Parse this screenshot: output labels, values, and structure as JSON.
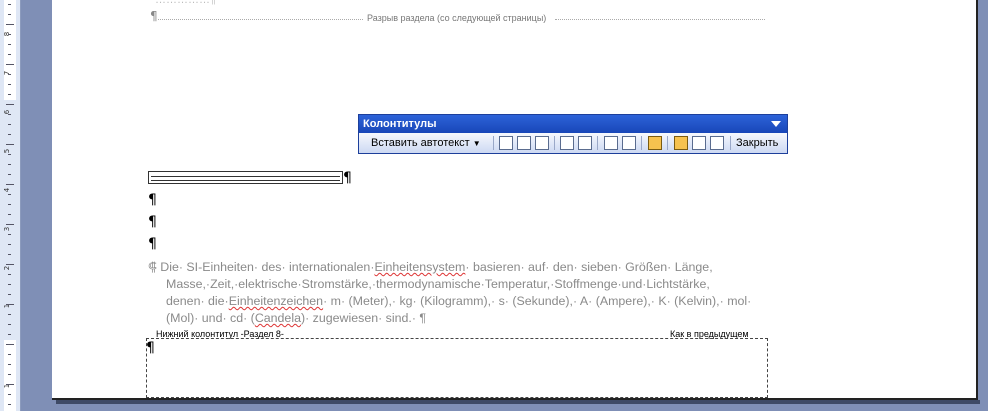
{
  "ruler": {
    "numbers": [
      "8",
      "7",
      "6",
      "5",
      "4",
      "3",
      "2",
      "1",
      "1"
    ]
  },
  "document": {
    "top_partial_text": "……………¶",
    "section_break_mark": "¶",
    "section_break_label": "Разрыв раздела (со следующей страницы)",
    "table_end_mark": "¶",
    "empty_para_1": "¶",
    "empty_para_2": "¶",
    "empty_para_3": "¶",
    "body_anchor": "⸿",
    "body_line1_a": "Die· SI-Einheiten· des· internationalen·",
    "body_line1_b": "Einheitensystem",
    "body_line1_c": "· basieren· auf· den· sieben· Größen· Länge,",
    "body_line2": "Masse,·Zeit,·elektrische·Stromstärke,·thermodynamische·Temperatur,·Stoffmenge·und·Lichtstärke,",
    "body_line3_a": "denen· die·",
    "body_line3_b": "Einheitenzeichen",
    "body_line3_c": "· m· (Meter),· kg· (Kilogramm),· s· (Sekunde),· A· (Ampere),· K· (Kelvin),· mol·",
    "body_line4_a": "(Mol)· und· cd· (",
    "body_line4_b": "Candela",
    "body_line4_c": ")· zugewiesen· sind.· ¶",
    "footer_label": "Нижний колонтитул -Раздел 8-",
    "footer_same": "Как в предыдущем",
    "footer_mark": "¶"
  },
  "toolbar": {
    "title": "Колонтитулы",
    "insert_autotext": "Вставить автотекст",
    "close": "Закрыть",
    "icons": [
      "insert-page-number-icon",
      "insert-page-count-icon",
      "format-page-number-icon",
      "insert-date-icon",
      "insert-time-icon",
      "page-setup-icon",
      "show-hide-text-icon",
      "same-as-previous-icon",
      "switch-header-footer-icon",
      "show-previous-icon",
      "show-next-icon"
    ]
  }
}
